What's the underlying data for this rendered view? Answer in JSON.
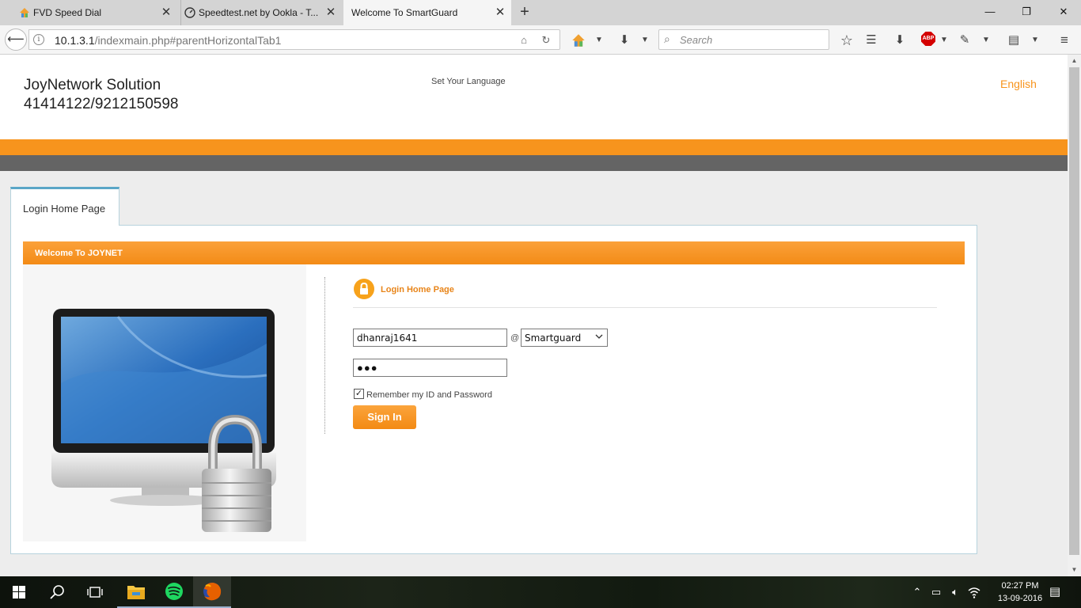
{
  "browser": {
    "tabs": [
      {
        "title": "FVD Speed Dial",
        "active": false
      },
      {
        "title": "Speedtest.net by Ookla - T...",
        "active": false
      },
      {
        "title": "Welcome To SmartGuard",
        "active": true
      }
    ],
    "url_host": "10.1.3.1",
    "url_path": "/indexmain.php#parentHorizontalTab1",
    "search_placeholder": "Search",
    "abp_label": "ABP"
  },
  "header": {
    "company_name": "JoyNetwork Solution",
    "company_phone": "41414122/9212150598",
    "set_language_label": "Set Your Language",
    "language": "English"
  },
  "content": {
    "tab_label": "Login Home Page",
    "welcome_bar": "Welcome To JOYNET",
    "login_title": "Login Home Page",
    "username_value": "dhanraj1641",
    "at_symbol": "@",
    "domain_selected": "Smartguard",
    "password_mask": "●●●",
    "remember_checked": true,
    "remember_label": "Remember my ID and Password",
    "signin_label": "Sign In"
  },
  "taskbar": {
    "time": "02:27 PM",
    "date": "13-09-2016"
  },
  "colors": {
    "accent_orange": "#f7941d",
    "band_grey": "#646464",
    "tab_blue": "#5aa6c7"
  }
}
